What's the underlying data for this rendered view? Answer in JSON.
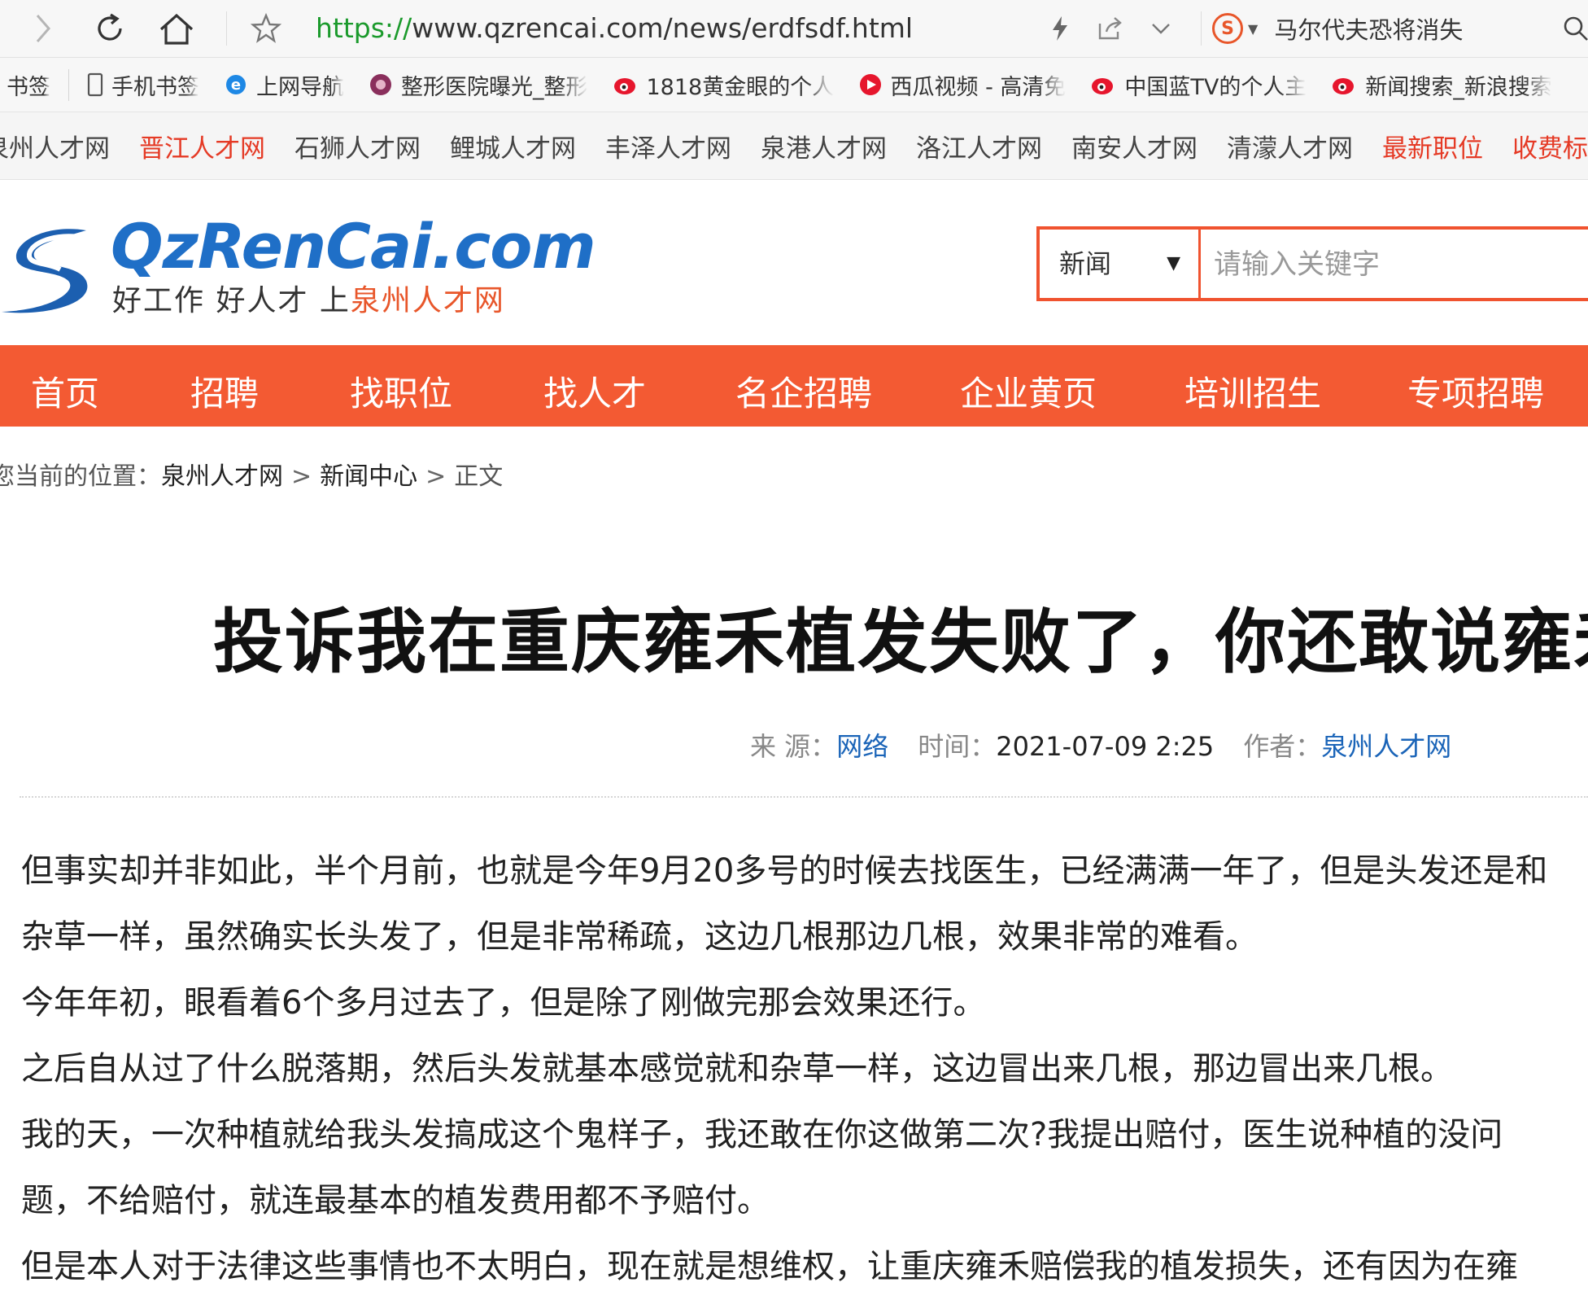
{
  "browser": {
    "url_proto": "https://",
    "url_rest": "www.qzrencai.com/news/erdfsdf.html",
    "search_suggest": "马尔代夫恐将消失",
    "bookmarks": [
      {
        "label": "书签",
        "icon": "bookmark-icon"
      },
      {
        "label": "手机书签",
        "icon": "phone-icon"
      },
      {
        "label": "上网导航",
        "icon": "ie-icon"
      },
      {
        "label": "整形医院曝光_整形",
        "icon": "hospital-icon"
      },
      {
        "label": "1818黄金眼的个人",
        "icon": "weibo-icon"
      },
      {
        "label": "西瓜视频 - 高清免",
        "icon": "xigua-icon"
      },
      {
        "label": "中国蓝TV的个人主",
        "icon": "weibo-icon"
      },
      {
        "label": "新闻搜索_新浪搜索",
        "icon": "weibo-icon"
      }
    ]
  },
  "sites": [
    {
      "label": "泉州人才网",
      "red": false
    },
    {
      "label": "晋江人才网",
      "red": true
    },
    {
      "label": "石狮人才网",
      "red": false
    },
    {
      "label": "鲤城人才网",
      "red": false
    },
    {
      "label": "丰泽人才网",
      "red": false
    },
    {
      "label": "泉港人才网",
      "red": false
    },
    {
      "label": "洛江人才网",
      "red": false
    },
    {
      "label": "南安人才网",
      "red": false
    },
    {
      "label": "清濛人才网",
      "red": false
    },
    {
      "label": "最新职位",
      "red": true
    },
    {
      "label": "收费标",
      "red": true
    }
  ],
  "header": {
    "logo_text": "QzRenCai.com",
    "slogan_a": "好工作 好人才 上",
    "slogan_b": "泉州人才网",
    "search_category": "新闻",
    "search_placeholder": "请输入关键字"
  },
  "nav": [
    "首页",
    "招聘",
    "找职位",
    "找人才",
    "名企招聘",
    "企业黄页",
    "培训招生",
    "专项招聘"
  ],
  "breadcrumb": {
    "prefix": "您当前的位置：",
    "items": [
      "泉州人才网",
      "新闻中心",
      "正文"
    ],
    "sep": ">"
  },
  "article": {
    "title": "投诉我在重庆雍禾植发失败了，你还敢说雍禾",
    "source_label": "来 源：",
    "source": "网络",
    "time_label": "时间：",
    "time": "2021-07-09 2:25",
    "author_label": "作者：",
    "author": "泉州人才网",
    "paragraphs": [
      "但事实却并非如此，半个月前，也就是今年9月20多号的时候去找医生，已经满满一年了，但是头发还是和杂草一样，虽然确实长头发了，但是非常稀疏，这边几根那边几根，效果非常的难看。",
      "今年年初，眼看着6个多月过去了，但是除了刚做完那会效果还行。",
      "之后自从过了什么脱落期，然后头发就基本感觉就和杂草一样，这边冒出来几根，那边冒出来几根。",
      "我的天，一次种植就给我头发搞成这个鬼样子，我还敢在你这做第二次?我提出赔付，医生说种植的没问题，不给赔付，就连最基本的植发费用都不予赔付。",
      "但是本人对于法律这些事情也不太明白，现在就是想维权，让重庆雍禾赔偿我的植发损失，还有因为在雍"
    ]
  }
}
